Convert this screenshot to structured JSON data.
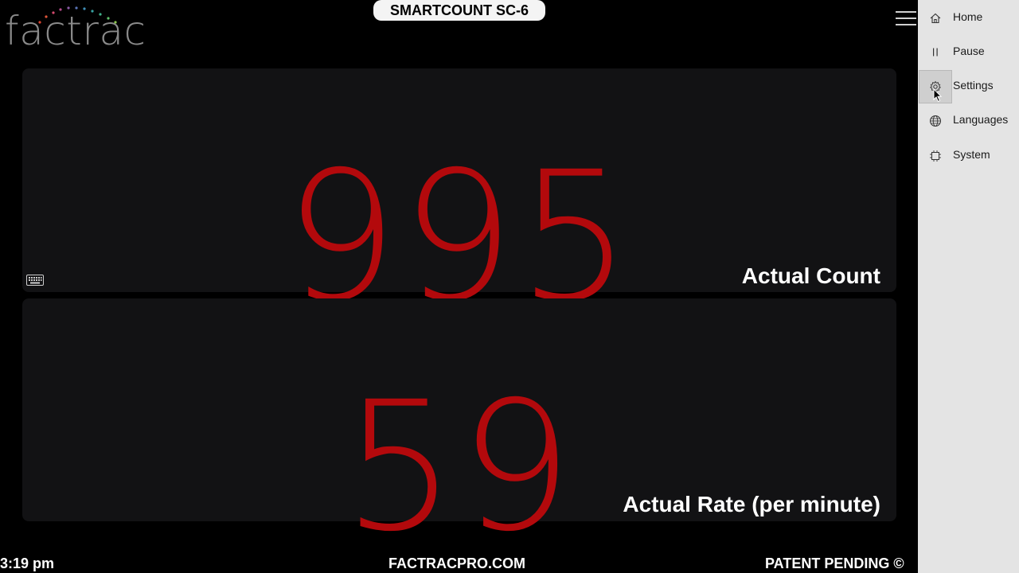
{
  "header": {
    "logo_text": "factrac",
    "title": "SMARTCOUNT SC-6",
    "menu_icon": "hamburger-icon"
  },
  "count_panel": {
    "value": "995",
    "label": "Actual Count",
    "value_color": "#b3090c"
  },
  "rate_panel": {
    "value": "59",
    "label": "Actual Rate (per minute)",
    "value_color": "#b3090c"
  },
  "keyboard_icon": "keyboard-icon",
  "footer": {
    "time": "3:19 pm",
    "website": "FACTRACPRO.COM",
    "patent": "PATENT PENDING ©"
  },
  "side_menu": {
    "items": [
      {
        "label": "Home",
        "icon": "home-icon"
      },
      {
        "label": "Pause",
        "icon": "pause-icon"
      },
      {
        "label": "Settings",
        "icon": "gear-icon"
      },
      {
        "label": "Languages",
        "icon": "globe-icon"
      },
      {
        "label": "System",
        "icon": "chip-icon"
      }
    ],
    "hovered": "Settings"
  },
  "colors": {
    "background": "#000000",
    "panel": "#121214",
    "accent_red": "#b3090c",
    "menu_bg": "#e4e4e4"
  }
}
